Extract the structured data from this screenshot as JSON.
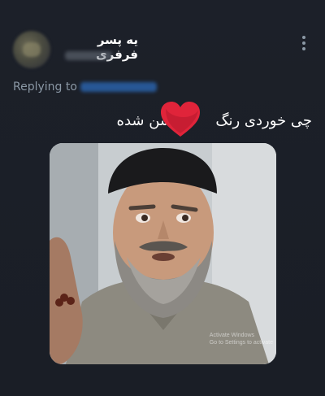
{
  "tweet": {
    "display_name": "یه پسر فرفری",
    "replying_label": "Replying to",
    "text_part_a": "چی خوردی رنگ",
    "text_part_b": "روشن شده",
    "media_watermark": {
      "line1": "Activate Windows",
      "line2": "Go to Settings to activate"
    }
  },
  "icons": {
    "more": "more-vertical-icon",
    "redaction": "red-heart-redaction-icon"
  },
  "colors": {
    "background": "#1b1f27",
    "text": "#ffffff",
    "secondary_text": "#8b98a5",
    "link": "#1d9bf0",
    "redaction": "#e0243a"
  }
}
